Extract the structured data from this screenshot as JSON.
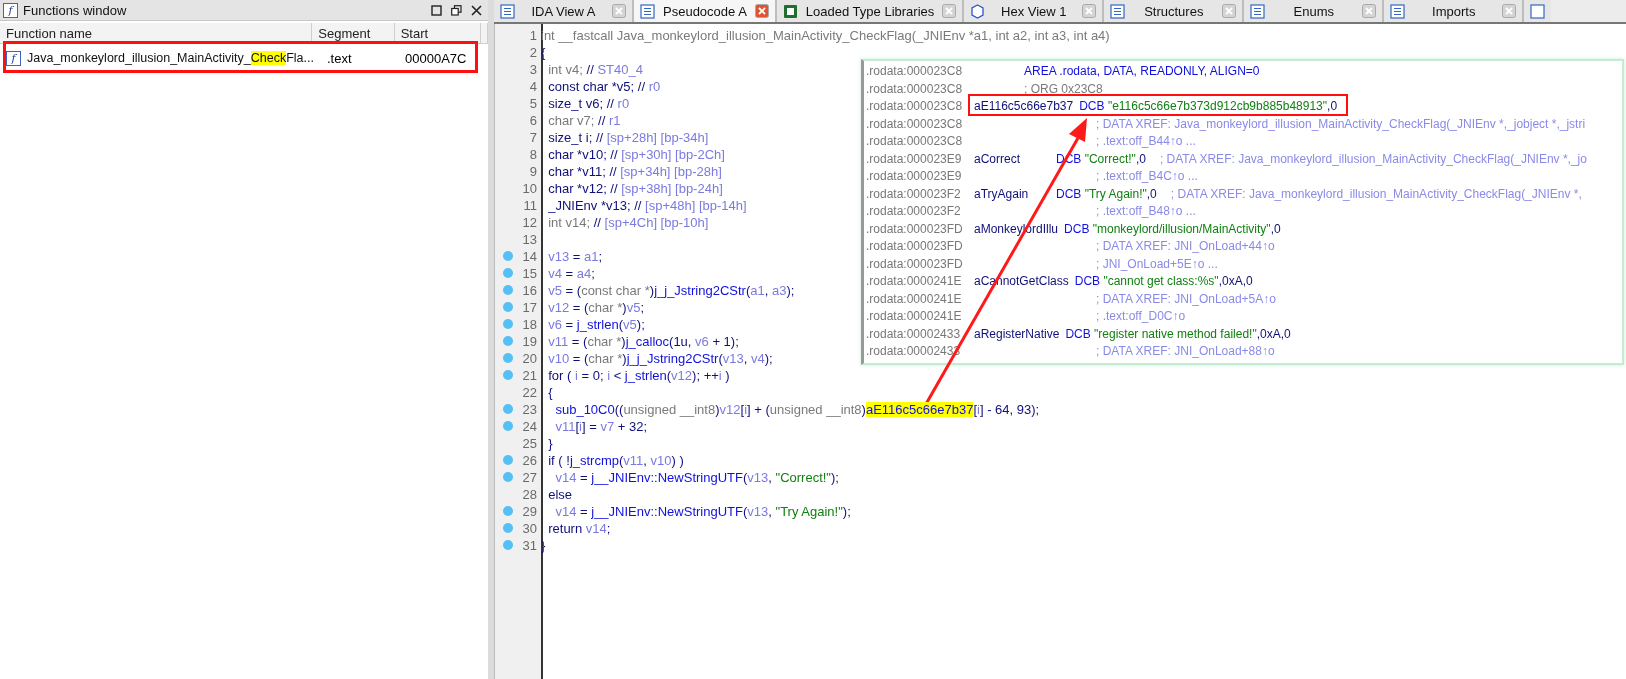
{
  "functions_window": {
    "title_icon": "f",
    "title": "Functions window",
    "columns": [
      "Function name",
      "Segment",
      "Start"
    ],
    "rows": [
      {
        "icon": "f",
        "name_parts": [
          {
            "text": "Java_monkeylord_illusion_MainActivity_",
            "highlight": false
          },
          {
            "text": "Check",
            "highlight": true
          },
          {
            "text": "Fla...",
            "highlight": false
          }
        ],
        "segment": ".text",
        "start": "00000A7C",
        "selected": false
      }
    ]
  },
  "tabs": [
    {
      "label": "IDA View A",
      "selected": false
    },
    {
      "label": "Pseudocode A",
      "selected": true
    },
    {
      "label": "Loaded Type Libraries",
      "selected": false
    },
    {
      "label": "Hex View 1",
      "selected": false
    },
    {
      "label": "Structures",
      "selected": false
    },
    {
      "label": "Enums",
      "selected": false
    },
    {
      "label": "Imports",
      "selected": false
    }
  ],
  "code_lines": [
    {
      "number": "1",
      "breakpoint": false,
      "segments": [
        {
          "kind": "g",
          "text": "int __fastcall Java_monkeylord_illusion_MainActivity_CheckFlag(_JNIEnv *a1, int a2, int a3, int a4)"
        }
      ]
    },
    {
      "number": "2",
      "breakpoint": false,
      "segments": [
        {
          "kind": "n",
          "text": "{"
        }
      ]
    },
    {
      "number": "3",
      "breakpoint": false,
      "segments": [
        {
          "kind": "g",
          "text": "  int v4; "
        },
        {
          "kind": "n",
          "text": "// "
        },
        {
          "kind": "v",
          "text": "ST40_4"
        }
      ]
    },
    {
      "number": "4",
      "breakpoint": false,
      "segments": [
        {
          "kind": "n",
          "text": "  const char *v5; // "
        },
        {
          "kind": "v",
          "text": "r0"
        }
      ]
    },
    {
      "number": "5",
      "breakpoint": false,
      "segments": [
        {
          "kind": "n",
          "text": "  size_t v6; // "
        },
        {
          "kind": "v",
          "text": "r0"
        }
      ]
    },
    {
      "number": "6",
      "breakpoint": false,
      "segments": [
        {
          "kind": "g",
          "text": "  char v7; "
        },
        {
          "kind": "n",
          "text": "// "
        },
        {
          "kind": "v",
          "text": "r1"
        }
      ]
    },
    {
      "number": "7",
      "breakpoint": false,
      "segments": [
        {
          "kind": "n",
          "text": "  size_t i; // "
        },
        {
          "kind": "v",
          "text": "[sp+28h] [bp-34h]"
        }
      ]
    },
    {
      "number": "8",
      "breakpoint": false,
      "segments": [
        {
          "kind": "n",
          "text": "  char *v10; // "
        },
        {
          "kind": "v",
          "text": "[sp+30h] [bp-2Ch]"
        }
      ]
    },
    {
      "number": "9",
      "breakpoint": false,
      "segments": [
        {
          "kind": "n",
          "text": "  char *v11; // "
        },
        {
          "kind": "v",
          "text": "[sp+34h] [bp-28h]"
        }
      ]
    },
    {
      "number": "10",
      "breakpoint": false,
      "segments": [
        {
          "kind": "n",
          "text": "  char *v12; // "
        },
        {
          "kind": "v",
          "text": "[sp+38h] [bp-24h]"
        }
      ]
    },
    {
      "number": "11",
      "breakpoint": false,
      "segments": [
        {
          "kind": "n",
          "text": "  _JNIEnv *v13; // "
        },
        {
          "kind": "v",
          "text": "[sp+48h] [bp-14h]"
        }
      ]
    },
    {
      "number": "12",
      "breakpoint": false,
      "segments": [
        {
          "kind": "g",
          "text": "  int v14; "
        },
        {
          "kind": "n",
          "text": "// "
        },
        {
          "kind": "v",
          "text": "[sp+4Ch] [bp-10h]"
        }
      ]
    },
    {
      "number": "13",
      "breakpoint": false
    },
    {
      "number": "14",
      "breakpoint": true,
      "segments": [
        {
          "kind": "v",
          "text": "  v13"
        },
        {
          "kind": "n",
          "text": " = "
        },
        {
          "kind": "v",
          "text": "a1"
        },
        {
          "kind": "n",
          "text": ";"
        }
      ]
    },
    {
      "number": "15",
      "breakpoint": true,
      "segments": [
        {
          "kind": "v",
          "text": "  v4"
        },
        {
          "kind": "n",
          "text": " = "
        },
        {
          "kind": "v",
          "text": "a4"
        },
        {
          "kind": "n",
          "text": ";"
        }
      ]
    },
    {
      "number": "16",
      "breakpoint": true,
      "segments": [
        {
          "kind": "v",
          "text": "  v5"
        },
        {
          "kind": "n",
          "text": " = ("
        },
        {
          "kind": "g",
          "text": "const char *"
        },
        {
          "kind": "n",
          "text": ")"
        },
        {
          "kind": "f",
          "text": "j_j_Jstring2CStr"
        },
        {
          "kind": "n",
          "text": "("
        },
        {
          "kind": "v",
          "text": "a1"
        },
        {
          "kind": "n",
          "text": ", "
        },
        {
          "kind": "v",
          "text": "a3"
        },
        {
          "kind": "n",
          "text": ");"
        }
      ]
    },
    {
      "number": "17",
      "breakpoint": true,
      "segments": [
        {
          "kind": "v",
          "text": "  v12"
        },
        {
          "kind": "n",
          "text": " = ("
        },
        {
          "kind": "g",
          "text": "char *"
        },
        {
          "kind": "n",
          "text": ")"
        },
        {
          "kind": "v",
          "text": "v5"
        },
        {
          "kind": "n",
          "text": ";"
        }
      ]
    },
    {
      "number": "18",
      "breakpoint": true,
      "segments": [
        {
          "kind": "v",
          "text": "  v6"
        },
        {
          "kind": "n",
          "text": " = "
        },
        {
          "kind": "f",
          "text": "j_strlen"
        },
        {
          "kind": "n",
          "text": "("
        },
        {
          "kind": "v",
          "text": "v5"
        },
        {
          "kind": "n",
          "text": ");"
        }
      ]
    },
    {
      "number": "19",
      "breakpoint": true,
      "segments": [
        {
          "kind": "v",
          "text": "  v11"
        },
        {
          "kind": "n",
          "text": " = ("
        },
        {
          "kind": "g",
          "text": "char *"
        },
        {
          "kind": "n",
          "text": ")"
        },
        {
          "kind": "f",
          "text": "j_calloc"
        },
        {
          "kind": "n",
          "text": "(1u, "
        },
        {
          "kind": "v",
          "text": "v6"
        },
        {
          "kind": "n",
          "text": " + 1);"
        }
      ]
    },
    {
      "number": "20",
      "breakpoint": true,
      "segments": [
        {
          "kind": "v",
          "text": "  v10"
        },
        {
          "kind": "n",
          "text": " = ("
        },
        {
          "kind": "g",
          "text": "char *"
        },
        {
          "kind": "n",
          "text": ")"
        },
        {
          "kind": "f",
          "text": "j_j_Jstring2CStr"
        },
        {
          "kind": "n",
          "text": "("
        },
        {
          "kind": "v",
          "text": "v13"
        },
        {
          "kind": "n",
          "text": ", "
        },
        {
          "kind": "v",
          "text": "v4"
        },
        {
          "kind": "n",
          "text": ");"
        }
      ]
    },
    {
      "number": "21",
      "breakpoint": true,
      "segments": [
        {
          "kind": "n",
          "text": "  for ( "
        },
        {
          "kind": "v",
          "text": "i"
        },
        {
          "kind": "n",
          "text": " = 0; "
        },
        {
          "kind": "v",
          "text": "i"
        },
        {
          "kind": "n",
          "text": " < "
        },
        {
          "kind": "f",
          "text": "j_strlen"
        },
        {
          "kind": "n",
          "text": "("
        },
        {
          "kind": "v",
          "text": "v12"
        },
        {
          "kind": "n",
          "text": "); ++"
        },
        {
          "kind": "v",
          "text": "i"
        },
        {
          "kind": "n",
          "text": " )"
        }
      ]
    },
    {
      "number": "22",
      "breakpoint": false,
      "segments": [
        {
          "kind": "n",
          "text": "  {"
        }
      ]
    },
    {
      "number": "23",
      "breakpoint": true,
      "segments": [
        {
          "kind": "f",
          "text": "    sub_10C0"
        },
        {
          "kind": "n",
          "text": "(("
        },
        {
          "kind": "g",
          "text": "unsigned __int8"
        },
        {
          "kind": "n",
          "text": ")"
        },
        {
          "kind": "v",
          "text": "v12"
        },
        {
          "kind": "n",
          "text": "["
        },
        {
          "kind": "v",
          "text": "i"
        },
        {
          "kind": "n",
          "text": "] + ("
        },
        {
          "kind": "g",
          "text": "unsigned __int8"
        },
        {
          "kind": "n",
          "text": ")"
        },
        {
          "kind": "h",
          "text": "aE116c5c66e7b37"
        },
        {
          "kind": "n",
          "text": "["
        },
        {
          "kind": "v",
          "text": "i"
        },
        {
          "kind": "n",
          "text": "] - 64, 93);"
        }
      ]
    },
    {
      "number": "24",
      "breakpoint": true,
      "segments": [
        {
          "kind": "v",
          "text": "    v11"
        },
        {
          "kind": "n",
          "text": "["
        },
        {
          "kind": "v",
          "text": "i"
        },
        {
          "kind": "n",
          "text": "] = "
        },
        {
          "kind": "v",
          "text": "v7"
        },
        {
          "kind": "n",
          "text": " + 32;"
        }
      ]
    },
    {
      "number": "25",
      "breakpoint": false,
      "segments": [
        {
          "kind": "n",
          "text": "  }"
        }
      ]
    },
    {
      "number": "26",
      "breakpoint": true,
      "segments": [
        {
          "kind": "n",
          "text": "  if ( !"
        },
        {
          "kind": "f",
          "text": "j_strcmp"
        },
        {
          "kind": "n",
          "text": "("
        },
        {
          "kind": "v",
          "text": "v11"
        },
        {
          "kind": "n",
          "text": ", "
        },
        {
          "kind": "v",
          "text": "v10"
        },
        {
          "kind": "n",
          "text": ") )"
        }
      ]
    },
    {
      "number": "27",
      "breakpoint": true,
      "segments": [
        {
          "kind": "v",
          "text": "    v14"
        },
        {
          "kind": "n",
          "text": " = "
        },
        {
          "kind": "f",
          "text": "j__JNIEnv::NewStringUTF"
        },
        {
          "kind": "n",
          "text": "("
        },
        {
          "kind": "v",
          "text": "v13"
        },
        {
          "kind": "n",
          "text": ", "
        },
        {
          "kind": "s",
          "text": "\"Correct!\""
        },
        {
          "kind": "n",
          "text": ");"
        }
      ]
    },
    {
      "number": "28",
      "breakpoint": false,
      "segments": [
        {
          "kind": "n",
          "text": "  else"
        }
      ]
    },
    {
      "number": "29",
      "breakpoint": true,
      "segments": [
        {
          "kind": "v",
          "text": "    v14"
        },
        {
          "kind": "n",
          "text": " = "
        },
        {
          "kind": "f",
          "text": "j__JNIEnv::NewStringUTF"
        },
        {
          "kind": "n",
          "text": "("
        },
        {
          "kind": "v",
          "text": "v13"
        },
        {
          "kind": "n",
          "text": ", "
        },
        {
          "kind": "s",
          "text": "\"Try Again!\""
        },
        {
          "kind": "n",
          "text": ");"
        }
      ]
    },
    {
      "number": "30",
      "breakpoint": true,
      "segments": [
        {
          "kind": "n",
          "text": "  return "
        },
        {
          "kind": "v",
          "text": "v14"
        },
        {
          "kind": "n",
          "text": ";"
        }
      ]
    },
    {
      "number": "31",
      "breakpoint": true,
      "segments": [
        {
          "kind": "n",
          "text": "}"
        }
      ]
    }
  ],
  "hint_lines": [
    {
      "kind": "directive",
      "address": ".rodata:000023C8",
      "segments": [
        {
          "kind": "k",
          "text": "AREA .rodata, DATA, READONLY, ALIGN=0"
        }
      ]
    },
    {
      "kind": "directive",
      "address": ".rodata:000023C8",
      "segments": [
        {
          "kind": "g",
          "text": "; ORG 0x23C8"
        }
      ]
    },
    {
      "kind": "def",
      "address": ".rodata:000023C8",
      "label": "aE116c5c66e7b37",
      "segments": [
        {
          "kind": "k",
          "text": "DCB "
        },
        {
          "kind": "s",
          "text": "\"e116c5c66e7b373d912cb9b885b48913\""
        },
        {
          "kind": "n",
          "text": ",0"
        }
      ]
    },
    {
      "kind": "comment",
      "address": ".rodata:000023C8",
      "comment": "; DATA XREF: Java_monkeylord_illusion_MainActivity_CheckFlag(_JNIEnv *,_jobject *,_jstri"
    },
    {
      "kind": "comment",
      "address": ".rodata:000023C8",
      "comment": "; .text:off_B44↑o ..."
    },
    {
      "kind": "def",
      "address": ".rodata:000023E9",
      "label": "aCorrect",
      "segments": [
        {
          "kind": "k",
          "text": "DCB "
        },
        {
          "kind": "s",
          "text": "\"Correct!\""
        },
        {
          "kind": "n",
          "text": ",0"
        }
      ],
      "comment": "; DATA XREF: Java_monkeylord_illusion_MainActivity_CheckFlag(_JNIEnv *,_jo"
    },
    {
      "kind": "comment",
      "address": ".rodata:000023E9",
      "comment": "; .text:off_B4C↑o ..."
    },
    {
      "kind": "def",
      "address": ".rodata:000023F2",
      "label": "aTryAgain",
      "segments": [
        {
          "kind": "k",
          "text": "DCB "
        },
        {
          "kind": "s",
          "text": "\"Try Again!\""
        },
        {
          "kind": "n",
          "text": ",0"
        }
      ],
      "comment": "; DATA XREF: Java_monkeylord_illusion_MainActivity_CheckFlag(_JNIEnv *,"
    },
    {
      "kind": "comment",
      "address": ".rodata:000023F2",
      "comment": "; .text:off_B48↑o ..."
    },
    {
      "kind": "def",
      "address": ".rodata:000023FD",
      "label": "aMonkeylordIllu",
      "segments": [
        {
          "kind": "k",
          "text": "DCB "
        },
        {
          "kind": "s",
          "text": "\"monkeylord/illusion/MainActivity\""
        },
        {
          "kind": "n",
          "text": ",0"
        }
      ]
    },
    {
      "kind": "comment",
      "address": ".rodata:000023FD",
      "comment": "; DATA XREF: JNI_OnLoad+44↑o"
    },
    {
      "kind": "comment",
      "address": ".rodata:000023FD",
      "comment": "; JNI_OnLoad+5E↑o ..."
    },
    {
      "kind": "def",
      "address": ".rodata:0000241E",
      "label": "aCannotGetClass",
      "segments": [
        {
          "kind": "k",
          "text": "DCB "
        },
        {
          "kind": "s",
          "text": "\"cannot get class:%s\""
        },
        {
          "kind": "n",
          "text": ",0xA,0"
        }
      ]
    },
    {
      "kind": "comment",
      "address": ".rodata:0000241E",
      "comment": "; DATA XREF: JNI_OnLoad+5A↑o"
    },
    {
      "kind": "comment",
      "address": ".rodata:0000241E",
      "comment": "; .text:off_D0C↑o"
    },
    {
      "kind": "def",
      "address": ".rodata:00002433",
      "label": "aRegisterNative",
      "segments": [
        {
          "kind": "k",
          "text": "DCB "
        },
        {
          "kind": "s",
          "text": "\"register native method failed!\""
        },
        {
          "kind": "n",
          "text": ",0xA,0"
        }
      ]
    },
    {
      "kind": "comment",
      "address": ".rodata:00002433",
      "comment": "; DATA XREF: JNI_OnLoad+88↑o"
    }
  ]
}
